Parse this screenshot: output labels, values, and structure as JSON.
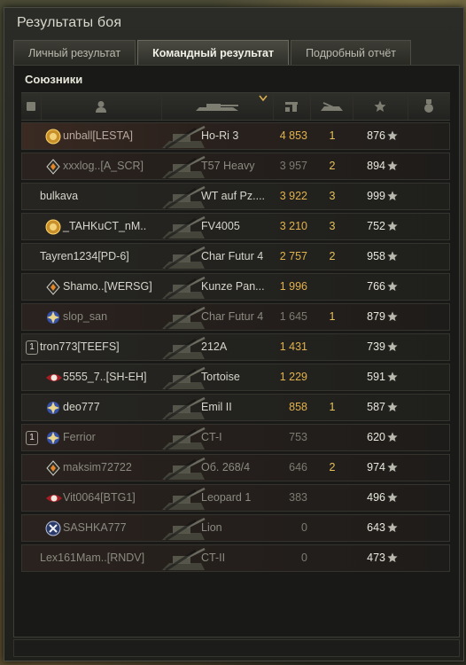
{
  "window": {
    "title": "Результаты боя"
  },
  "tabs": [
    {
      "label": "Личный результат",
      "active": false
    },
    {
      "label": "Командный результат",
      "active": true
    },
    {
      "label": "Подробный отчёт",
      "active": false
    }
  ],
  "section": {
    "label": "Союзники"
  },
  "colors": {
    "damage": "#e2b24e",
    "kills": "#e6c15c",
    "text": "#d6d6cc",
    "dead_text": "#8b8b80"
  },
  "header_icons": [
    "square-icon",
    "player-icon",
    "tank-icon",
    "sort-chevron-icon",
    "damage-icon",
    "kills-icon",
    "star-icon",
    "medal-icon"
  ],
  "players": [
    {
      "name": "unball[LESTA]",
      "tank": "Ho-Ri 3",
      "damage": "4 853",
      "kills": "1",
      "xp": "876",
      "badge": "gold",
      "platoon": "",
      "state": "self"
    },
    {
      "name": "xxxlog..[A_SCR]",
      "tank": "T57 Heavy",
      "damage": "3 957",
      "kills": "2",
      "xp": "894",
      "badge": "diamond",
      "platoon": "",
      "state": "dead"
    },
    {
      "name": "bulkava",
      "tank": "WT auf Pz....",
      "damage": "3 922",
      "kills": "3",
      "xp": "999",
      "badge": "",
      "platoon": "",
      "state": "alive"
    },
    {
      "name": "_TAHKuCT_nM..",
      "tank": "FV4005",
      "damage": "3 210",
      "kills": "3",
      "xp": "752",
      "badge": "gold",
      "platoon": "",
      "state": "alive"
    },
    {
      "name": "Tayren1234[PD-6]",
      "tank": "Char Futur 4",
      "damage": "2 757",
      "kills": "2",
      "xp": "958",
      "badge": "",
      "platoon": "",
      "state": "alive"
    },
    {
      "name": "Shamo..[WERSG]",
      "tank": "Kunze Pan...",
      "damage": "1 996",
      "kills": "",
      "xp": "766",
      "badge": "diamond",
      "platoon": "",
      "state": "alive"
    },
    {
      "name": "slop_san",
      "tank": "Char Futur 4",
      "damage": "1 645",
      "kills": "1",
      "xp": "879",
      "badge": "blue",
      "platoon": "",
      "state": "dead"
    },
    {
      "name": "tron773[TEEFS]",
      "tank": "212A",
      "damage": "1 431",
      "kills": "",
      "xp": "739",
      "badge": "",
      "platoon": "1",
      "state": "alive"
    },
    {
      "name": "5555_7..[SH-EH]",
      "tank": "Tortoise",
      "damage": "1 229",
      "kills": "",
      "xp": "591",
      "badge": "red",
      "platoon": "",
      "state": "alive"
    },
    {
      "name": "deo777",
      "tank": "Emil II",
      "damage": "858",
      "kills": "1",
      "xp": "587",
      "badge": "blue",
      "platoon": "",
      "state": "alive"
    },
    {
      "name": "Ferrior",
      "tank": "CT-I",
      "damage": "753",
      "kills": "",
      "xp": "620",
      "badge": "blue",
      "platoon": "1",
      "state": "dead"
    },
    {
      "name": "maksim72722",
      "tank": "Об. 268/4",
      "damage": "646",
      "kills": "2",
      "xp": "974",
      "badge": "diamond",
      "platoon": "",
      "state": "dead"
    },
    {
      "name": "Vit0064[BTG1]",
      "tank": "Leopard 1",
      "damage": "383",
      "kills": "",
      "xp": "496",
      "badge": "red",
      "platoon": "",
      "state": "dead"
    },
    {
      "name": "SASHKA777",
      "tank": "Lion",
      "damage": "0",
      "kills": "",
      "xp": "643",
      "badge": "cross",
      "platoon": "",
      "state": "dead"
    },
    {
      "name": "Lex161Mam..[RNDV]",
      "tank": "CT-II",
      "damage": "0",
      "kills": "",
      "xp": "473",
      "badge": "",
      "platoon": "",
      "state": "dead"
    }
  ]
}
